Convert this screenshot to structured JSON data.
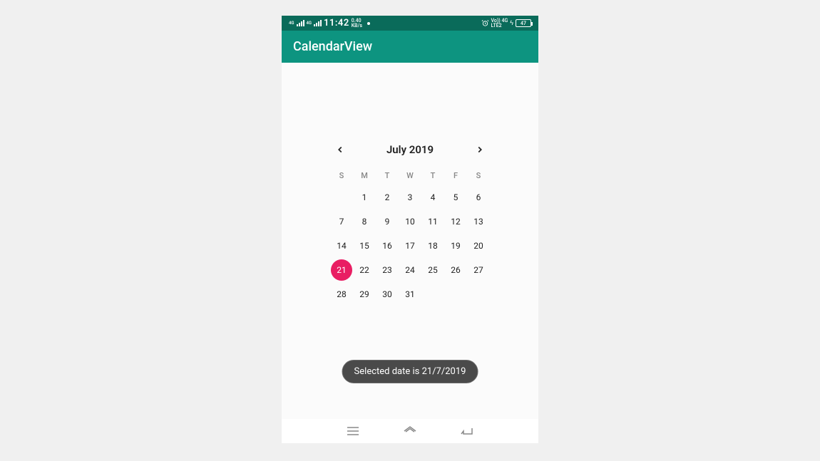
{
  "status_bar": {
    "network1": "4G",
    "network2": "4G",
    "time": "11:42",
    "data_rate": "0.40",
    "data_unit": "KB/s",
    "alarm_icon": "alarm",
    "sim_label": "Vo)) 4G",
    "sim_sub": "LTE2",
    "battery": "47"
  },
  "app_bar": {
    "title": "CalendarView"
  },
  "calendar": {
    "month_label": "July 2019",
    "dow": [
      "S",
      "M",
      "T",
      "W",
      "T",
      "F",
      "S"
    ],
    "leading_blanks": 1,
    "days": [
      "1",
      "2",
      "3",
      "4",
      "5",
      "6",
      "7",
      "8",
      "9",
      "10",
      "11",
      "12",
      "13",
      "14",
      "15",
      "16",
      "17",
      "18",
      "19",
      "20",
      "21",
      "22",
      "23",
      "24",
      "25",
      "26",
      "27",
      "28",
      "29",
      "30",
      "31"
    ],
    "selected_day": "21"
  },
  "toast": {
    "message": "Selected date is 21/7/2019"
  },
  "colors": {
    "status_bg": "#0a6b5a",
    "appbar_bg": "#0d9480",
    "accent": "#e91e63"
  }
}
